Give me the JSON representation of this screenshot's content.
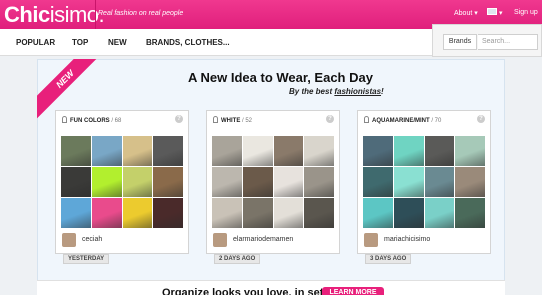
{
  "header": {
    "logo_bold": "Chic",
    "logo_thin": "isimo.",
    "tagline": "Real fashion on real people",
    "about": "About",
    "signup": "Sign up",
    "flag_icon": "uk-flag-icon"
  },
  "subnav": {
    "items": [
      "POPULAR",
      "TOP",
      "NEW",
      "BRANDS, CLOTHES..."
    ],
    "brands_button": "Brands",
    "search_placeholder": "Search..."
  },
  "hero": {
    "badge": "NEW",
    "headline": "A New Idea to Wear, Each Day",
    "subhead_prefix": "By the best ",
    "subhead_emph": "fashionistas",
    "subhead_suffix": "!"
  },
  "cards": [
    {
      "title": "FUN COLORS",
      "count": "/ 68",
      "author": "ceciah",
      "time": "YESTERDAY",
      "palette": [
        "#6b7a5c",
        "#79a7c6",
        "#d6c08a",
        "#5a5a5a",
        "#3a3a38",
        "#b2ef2e",
        "#c4d06a",
        "#8a6a4a",
        "#5ea7d8",
        "#e94b8c",
        "#eccb2e",
        "#4a2a2a"
      ]
    },
    {
      "title": "WHITE",
      "count": "/ 52",
      "author": "elarmariodemamen",
      "time": "2 DAYS AGO",
      "palette": [
        "#a9a49a",
        "#eae7e0",
        "#8a7a6a",
        "#d9d5cc",
        "#bcb7ae",
        "#6b5a4a",
        "#e7e2dd",
        "#9a948a",
        "#c9c2b7",
        "#7a7468",
        "#e3dfd8",
        "#5a564e"
      ]
    },
    {
      "title": "AQUAMARINE/MINT",
      "count": "/ 70",
      "author": "mariachicisimo",
      "time": "3 DAYS AGO",
      "palette": [
        "#4f6b7a",
        "#6fd4c2",
        "#5a5a58",
        "#a6c9b8",
        "#3f6a6e",
        "#8ae0d2",
        "#6a8a92",
        "#9a8a7a",
        "#5cc6c4",
        "#2e4e58",
        "#7ad0c8",
        "#4a6a5a"
      ]
    }
  ],
  "bottom": {
    "text": "Organize looks you love, in sets!",
    "button": "LEARN MORE"
  }
}
